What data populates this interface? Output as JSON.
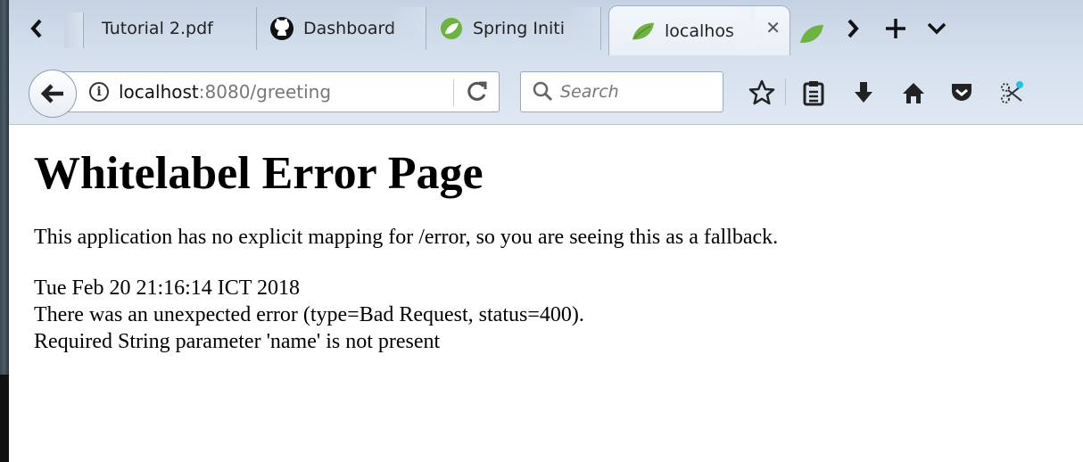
{
  "tabs": [
    {
      "title": "Tutorial 2.pdf",
      "icon": "pdf-file-icon"
    },
    {
      "title": "Dashboard",
      "icon": "github-icon"
    },
    {
      "title": "Spring Initi",
      "icon": "spring-leaf-icon"
    },
    {
      "title": "localhos",
      "icon": "spring-leaf-icon",
      "active": true
    }
  ],
  "address_bar": {
    "host": "localhost",
    "path": ":8080/greeting"
  },
  "search": {
    "placeholder": "Search"
  },
  "page": {
    "heading": "Whitelabel Error Page",
    "message": "This application has no explicit mapping for /error, so you are seeing this as a fallback.",
    "timestamp": "Tue Feb 20 21:16:14 ICT 2018",
    "error_line": "There was an unexpected error (type=Bad Request, status=400).",
    "detail_line": "Required String parameter 'name' is not present"
  },
  "colors": {
    "chrome_bg": "#d5e0ed",
    "spring_green": "#6db33f"
  }
}
